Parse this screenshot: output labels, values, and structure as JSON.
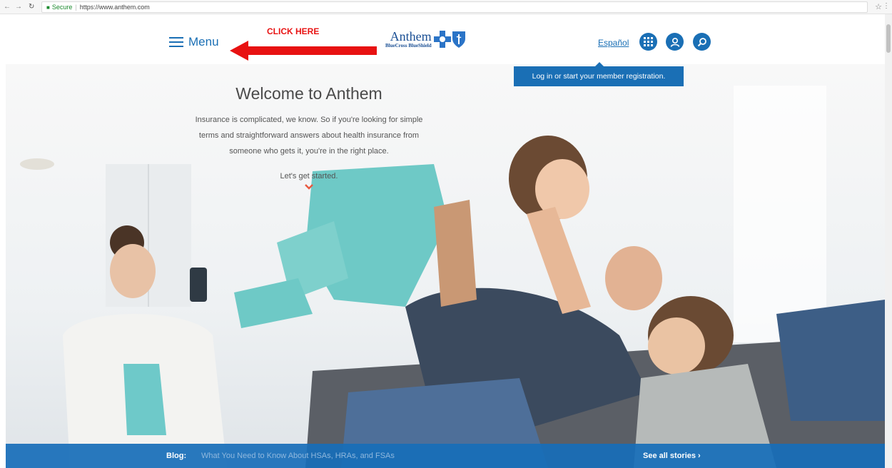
{
  "browser": {
    "secure_label": "Secure",
    "url": "https://www.anthem.com"
  },
  "header": {
    "menu_label": "Menu",
    "annotation": "CLICK HERE",
    "logo_word": "Anthem",
    "logo_sub": "BlueCross BlueShield",
    "espanol": "Español"
  },
  "tooltip": {
    "text": "Log in or start your member registration."
  },
  "hero": {
    "title": "Welcome to Anthem",
    "body_line1": "Insurance is complicated, we know. So if you're looking for simple",
    "body_line2": "terms and straightforward answers about health insurance from",
    "body_line3": "someone who gets it, you're in the right place.",
    "cta": "Let's get started."
  },
  "blog": {
    "label": "Blog:",
    "link": "What You Need to Know About HSAs, HRAs, and FSAs",
    "see_all": "See all stories  ›"
  },
  "colors": {
    "brand_blue": "#1a6fb5",
    "annotation_red": "#e81212",
    "chevron_red": "#e8583f"
  }
}
